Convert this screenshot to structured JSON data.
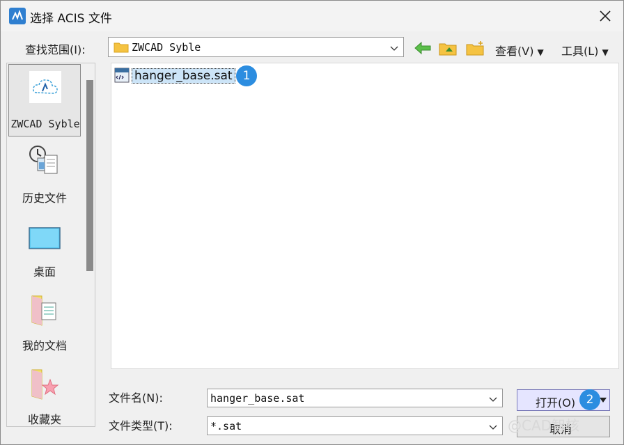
{
  "window": {
    "title": "选择 ACIS 文件"
  },
  "lookin": {
    "label": "查找范围(I):",
    "value": "ZWCAD Syble",
    "view_label": "查看(V)",
    "tools_label": "工具(L)"
  },
  "places": [
    {
      "label": "ZWCAD Syble",
      "icon": "cloud-icon"
    },
    {
      "label": "历史文件",
      "icon": "history-icon"
    },
    {
      "label": "桌面",
      "icon": "desktop-icon"
    },
    {
      "label": "我的文档",
      "icon": "documents-icon"
    },
    {
      "label": "收藏夹",
      "icon": "favorites-icon"
    }
  ],
  "files": [
    {
      "name": "hanger_base.sat",
      "icon": "sat-file-icon"
    }
  ],
  "filename": {
    "label": "文件名(N):",
    "value": "hanger_base.sat"
  },
  "filetype": {
    "label": "文件类型(T):",
    "value": "*.sat"
  },
  "buttons": {
    "open": "打开(O)",
    "cancel": "取消"
  },
  "badges": {
    "one": "1",
    "two": "2"
  },
  "watermark": "@CAD智核",
  "colors": {
    "badge": "#2c8de0",
    "selection": "#cce4f7",
    "open_button": "#e5e5ff"
  }
}
